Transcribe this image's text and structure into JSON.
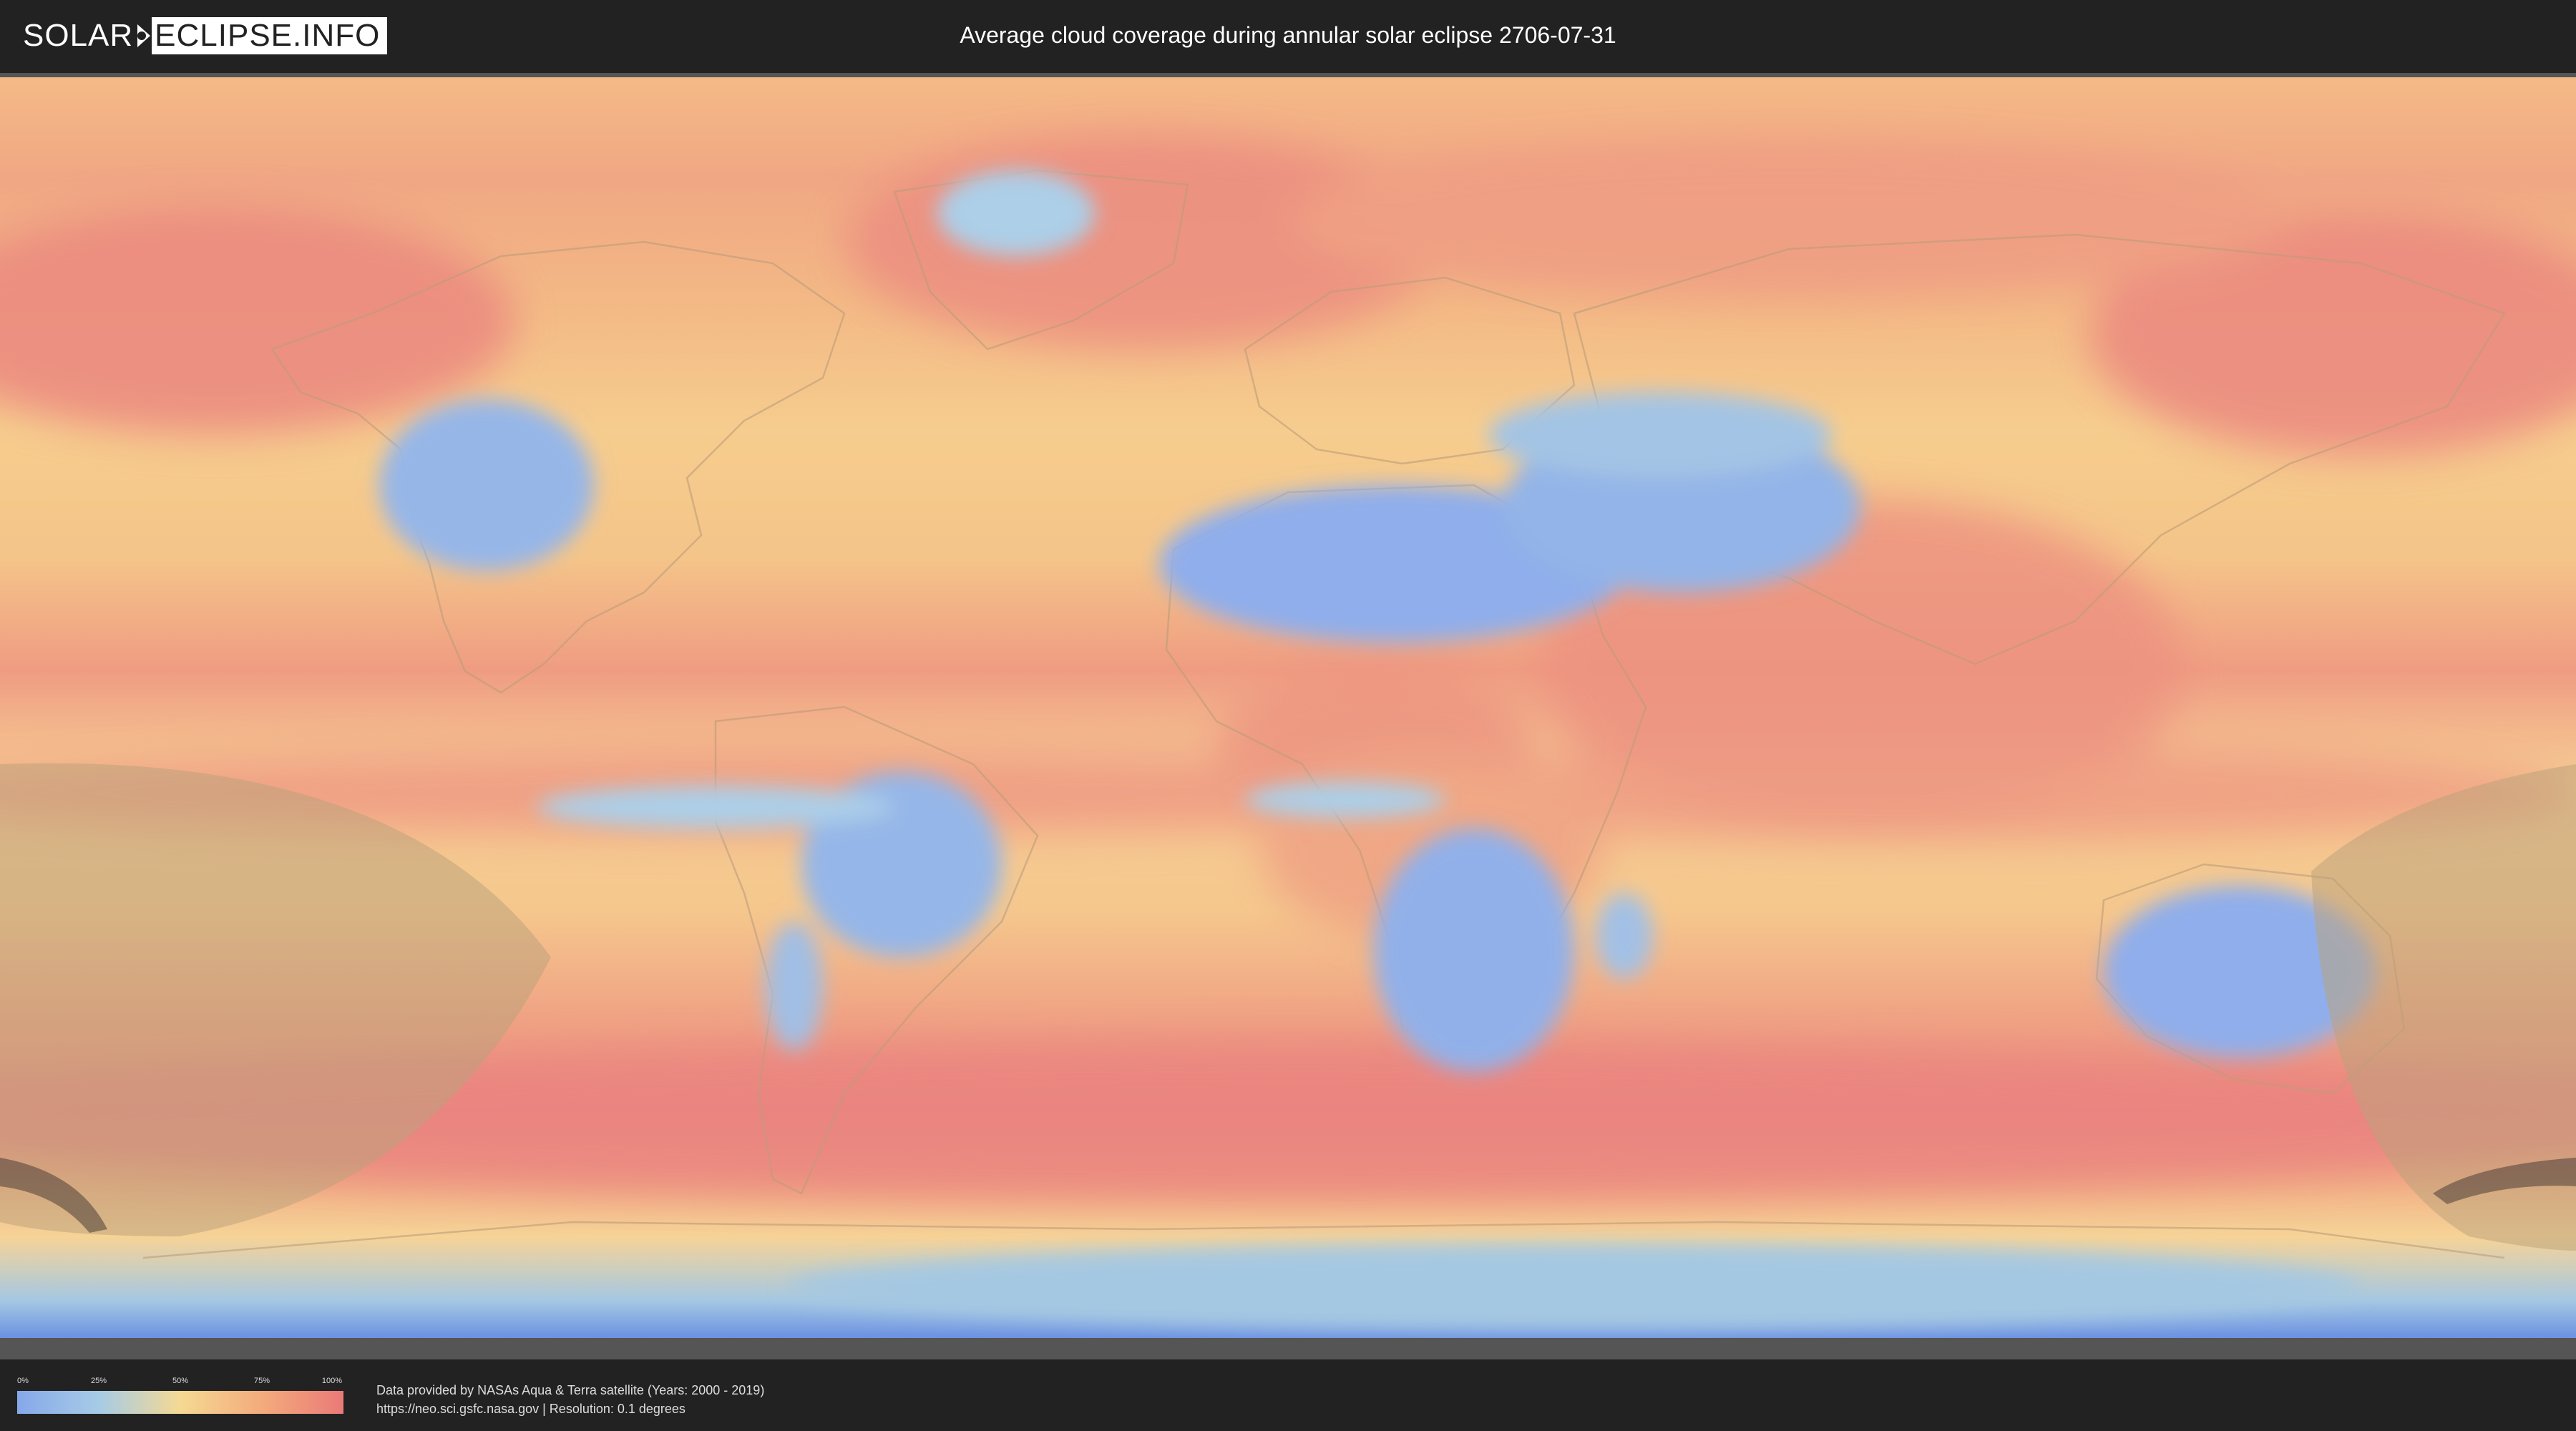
{
  "header": {
    "logo_solar": "SOLAR",
    "logo_eclipse": "ECLIPSE.INFO",
    "title": "Average cloud coverage during annular solar eclipse 2706-07-31"
  },
  "map": {
    "type": "world cloud coverage map",
    "projection": "equirectangular",
    "shaded_region": "eclipse visibility overlay (southern Pacific, left and right edges)",
    "colors": {
      "low": "#86a8ea",
      "mid": "#f5d993",
      "high": "#ea7a78"
    }
  },
  "legend": {
    "ticks": [
      "0%",
      "25%",
      "50%",
      "75%",
      "100%"
    ],
    "gradient": [
      "#86a8ea",
      "#a6cbe6",
      "#f5d993",
      "#f3ab7c",
      "#ea7a78"
    ]
  },
  "footer": {
    "source_line1": "Data provided by NASAs Aqua & Terra satellite (Years: 2000 - 2019)",
    "source_line2": "https://neo.sci.gsfc.nasa.gov | Resolution: 0.1 degrees"
  }
}
